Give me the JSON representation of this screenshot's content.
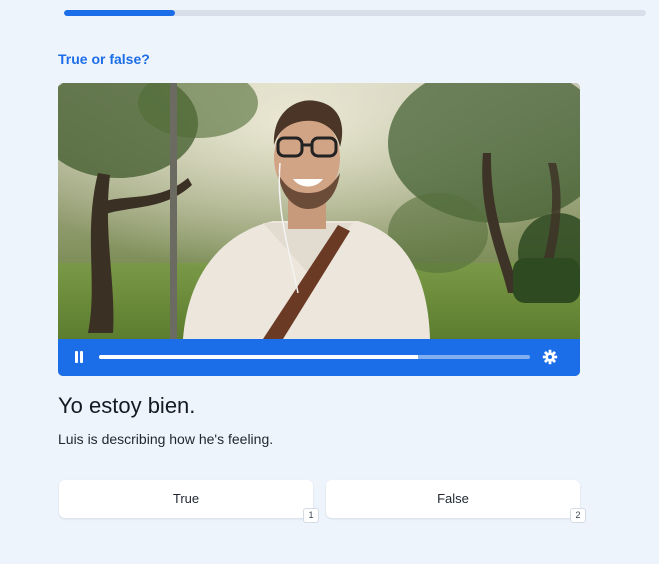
{
  "lesson": {
    "progress_fraction": 0.19
  },
  "question": {
    "label": "True or false?"
  },
  "video": {
    "playback_fraction": 0.74,
    "pause_icon": "pause-icon",
    "settings_icon": "gear-icon",
    "colors": {
      "controls_bar": "#1c6ee8"
    }
  },
  "prompt": {
    "phrase": "Yo estoy bien.",
    "description": "Luis is describing how he's feeling."
  },
  "answers": [
    {
      "label": "True",
      "shortcut": "1"
    },
    {
      "label": "False",
      "shortcut": "2"
    }
  ],
  "colors": {
    "accent": "#1c6ee8",
    "background": "#eef4fc"
  }
}
